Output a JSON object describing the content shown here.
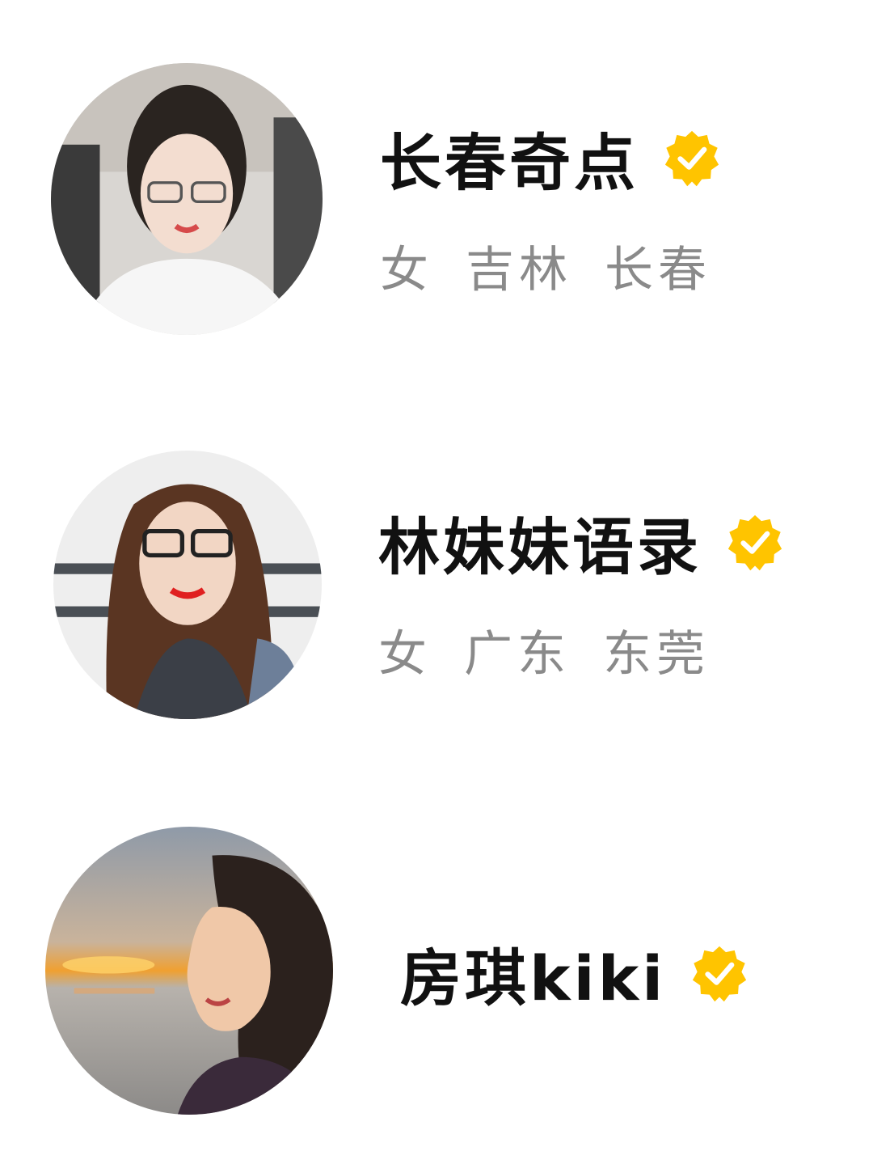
{
  "profiles": [
    {
      "name": "长春奇点",
      "verified": true,
      "gender": "女",
      "province": "吉林",
      "city": "长春",
      "avatar_icon": "portrait-woman-in-car"
    },
    {
      "name": "林妹妹语录",
      "verified": true,
      "gender": "女",
      "province": "广东",
      "city": "东莞",
      "avatar_icon": "portrait-woman-glasses"
    },
    {
      "name": "房琪kiki",
      "verified": true,
      "avatar_icon": "portrait-woman-sunset"
    }
  ],
  "colors": {
    "badge": "#FFC400",
    "name": "#111111",
    "info": "#8A8A8A",
    "background": "#FFFFFF"
  }
}
